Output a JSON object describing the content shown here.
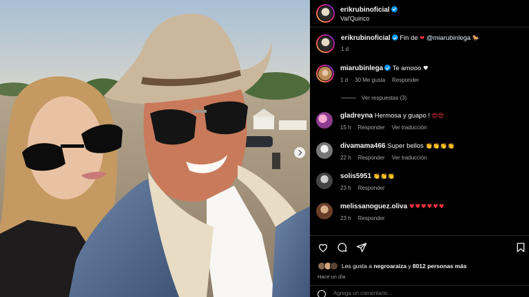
{
  "post": {
    "author": "erikrubinoficial",
    "location": "Val'Quirico",
    "caption_text": "Fin de",
    "caption_heart": "❤",
    "caption_mention": "@miarubinlega",
    "caption_emoji": "🐎",
    "caption_time": "1 d"
  },
  "comments": [
    {
      "user": "miarubinlega",
      "verified": true,
      "text": "Te amooo",
      "emoji": "♥",
      "time": "1 d",
      "likes": "30 Me gusta",
      "reply": "Responder",
      "translate": "",
      "replies_label": "Ver respuestas (3)"
    },
    {
      "user": "gladreyna",
      "text": "Hermosa y guapo !",
      "emoji": "😍😍",
      "time": "15 h",
      "reply": "Responder",
      "translate": "Ver traducción"
    },
    {
      "user": "divamama466",
      "text": "Super bellos",
      "emoji": "👏👏👏👏",
      "time": "22 h",
      "reply": "Responder",
      "translate": "Ver traducción"
    },
    {
      "user": "solis5951",
      "text": "",
      "emoji": "👏👏👏",
      "time": "23 h",
      "reply": "Responder",
      "translate": ""
    },
    {
      "user": "melissanoguez.oliva",
      "text": "",
      "emoji": "♥♥♥♥♥♥",
      "time": "23 h",
      "reply": "Responder",
      "translate": ""
    }
  ],
  "actions": {
    "likes_prefix": "Les gusta a",
    "likes_user": "negroaraiza",
    "likes_middle": "y",
    "likes_count": "8012 personas más",
    "time_ago": "Hace un día",
    "comment_placeholder": "Agrega un comentario..."
  },
  "icons": [
    "heart-icon",
    "comment-icon",
    "share-icon",
    "bookmark-icon",
    "emoji-icon",
    "next-arrow-icon",
    "verified-icon"
  ],
  "colors": {
    "background": "#000000",
    "verified": "#0095f6",
    "heart": "#ff3040",
    "meta_text": "#a8a8a8"
  }
}
